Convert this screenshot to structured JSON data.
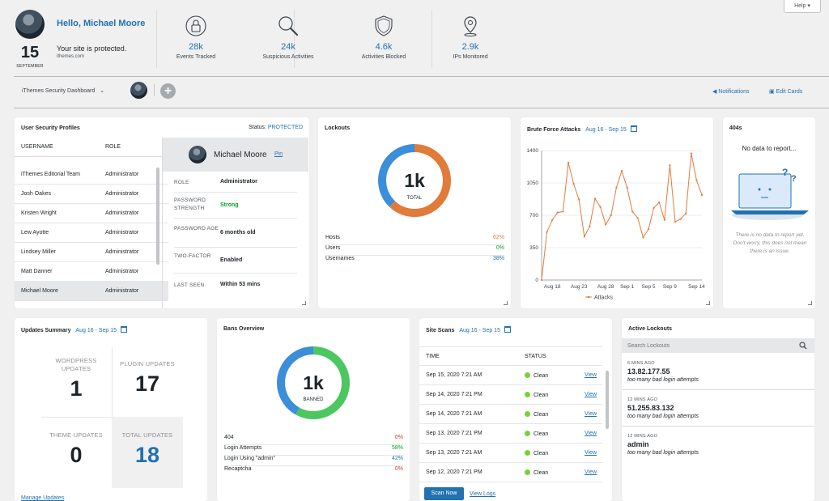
{
  "header": {
    "greeting": "Hello, Michael Moore",
    "status": "Your site is protected.",
    "site": "ithemes.com",
    "date_day": "15",
    "date_month": "SEPTEMBER",
    "help_label": "Help ▾",
    "stats": [
      {
        "icon": "lock-icon",
        "value": "28k",
        "label": "Events Tracked"
      },
      {
        "icon": "magnifier-icon",
        "value": "24k",
        "label": "Suspicious Activities"
      },
      {
        "icon": "shield-icon",
        "value": "4.6k",
        "label": "Activities Blocked"
      },
      {
        "icon": "map-pin-icon",
        "value": "2.9k",
        "label": "IPs Monitored"
      }
    ]
  },
  "toolbar": {
    "dashboard_select": "iThemes Security Dashboard",
    "add_symbol": "+",
    "notifications": "Notifications",
    "edit_cards": "Edit Cards"
  },
  "user_profiles": {
    "title": "User Security Profiles",
    "status_label": "Status:",
    "status_value": "PROTECTED",
    "col_username": "USERNAME",
    "col_role": "ROLE",
    "rows": [
      {
        "name": "iThemes Editorial Team",
        "role": "Administrator"
      },
      {
        "name": "Josh Oakes",
        "role": "Administrator"
      },
      {
        "name": "Kristen Wright",
        "role": "Administrator"
      },
      {
        "name": "Lew Ayotte",
        "role": "Administrator"
      },
      {
        "name": "Lindsey Miller",
        "role": "Administrator"
      },
      {
        "name": "Matt Danner",
        "role": "Administrator"
      },
      {
        "name": "Michael Moore",
        "role": "Administrator"
      }
    ],
    "detail": {
      "name": "Michael Moore",
      "pin": "Pin",
      "role_k": "ROLE",
      "role_v": "Administrator",
      "pw_k": "PASSWORD STRENGTH",
      "pw_v": "Strong",
      "age_k": "PASSWORD AGE",
      "age_v": "6 months old",
      "tf_k": "TWO-FACTOR",
      "tf_v": "Enabled",
      "seen_k": "LAST SEEN",
      "seen_v": "Within 53 mins"
    }
  },
  "lockouts": {
    "title": "Lockouts",
    "total": "1k",
    "total_label": "TOTAL",
    "rows": [
      {
        "label": "Hosts",
        "value": "62%"
      },
      {
        "label": "Users",
        "value": "0%"
      },
      {
        "label": "Usernames",
        "value": "38%"
      }
    ],
    "colors": {
      "hosts": "#e07b3a",
      "usernames": "#3b8ed9"
    }
  },
  "brute_force": {
    "title": "Brute Force Attacks",
    "range": "Aug 16 - Sep 15",
    "legend": "Attacks"
  },
  "chart_data": {
    "type": "line",
    "title": "Brute Force Attacks",
    "xlabel": "",
    "ylabel": "",
    "ylim": [
      0,
      1400
    ],
    "yticks": [
      0,
      350,
      700,
      1050,
      1400
    ],
    "xtick_labels": [
      "Aug 18",
      "Aug 23",
      "Aug 28",
      "Sep 1",
      "Sep 5",
      "Sep 9",
      "Sep 14"
    ],
    "xtick_index": [
      2,
      7,
      12,
      16,
      20,
      24,
      29
    ],
    "series": [
      {
        "name": "Attacks",
        "color": "#e07b3a",
        "values": [
          0,
          520,
          650,
          730,
          740,
          1270,
          1040,
          870,
          470,
          580,
          880,
          790,
          600,
          700,
          1000,
          1180,
          1000,
          740,
          670,
          460,
          550,
          780,
          840,
          650,
          1240,
          630,
          660,
          720,
          1370,
          1080,
          920
        ]
      }
    ]
  },
  "no_404": {
    "title": "404s",
    "message": "No data to report...",
    "note": "There is no data to report yet. Don't worry, this does not mean there is an issue."
  },
  "updates": {
    "title": "Updates Summary",
    "range": "Aug 16 - Sep 15",
    "wp_label": "WORDPRESS UPDATES",
    "wp_value": "1",
    "plugin_label": "PLUGIN UPDATES",
    "plugin_value": "17",
    "theme_label": "THEME UPDATES",
    "theme_value": "0",
    "total_label": "TOTAL UPDATES",
    "total_value": "18",
    "manage": "Manage Updates"
  },
  "bans": {
    "title": "Bans Overview",
    "total": "1k",
    "total_label": "BANNED",
    "rows": [
      {
        "label": "404",
        "value": "0%"
      },
      {
        "label": "Login Attempts",
        "value": "58%"
      },
      {
        "label": "Login Using \"admin\"",
        "value": "42%"
      },
      {
        "label": "Recaptcha",
        "value": "0%"
      }
    ],
    "colors": {
      "login": "#4cc65f",
      "admin": "#3b8ed9"
    }
  },
  "scans": {
    "title": "Site Scans",
    "range": "Aug 16 - Sep 15",
    "col_time": "TIME",
    "col_status": "STATUS",
    "rows": [
      {
        "time": "Sep 15, 2020 7:21 AM",
        "status": "Clean",
        "action": "View"
      },
      {
        "time": "Sep 14, 2020 7:21 PM",
        "status": "Clean",
        "action": "View"
      },
      {
        "time": "Sep 14, 2020 7:21 AM",
        "status": "Clean",
        "action": "View"
      },
      {
        "time": "Sep 13, 2020 7:21 PM",
        "status": "Clean",
        "action": "View"
      },
      {
        "time": "Sep 13, 2020 7:21 AM",
        "status": "Clean",
        "action": "View"
      },
      {
        "time": "Sep 12, 2020 7:21 PM",
        "status": "Clean",
        "action": "View"
      }
    ],
    "scan_now": "Scan Now",
    "view_logs": "View Logs"
  },
  "active_lockouts": {
    "title": "Active Lockouts",
    "search_placeholder": "Search Lockouts",
    "items": [
      {
        "ago": "6 MINS AGO",
        "ip": "13.82.177.55",
        "reason": "too many bad login attempts"
      },
      {
        "ago": "12 MINS AGO",
        "ip": "51.255.83.132",
        "reason": "too many bad login attempts"
      },
      {
        "ago": "12 MINS AGO",
        "ip": "admin",
        "reason": "too many bad login attempts"
      }
    ]
  }
}
